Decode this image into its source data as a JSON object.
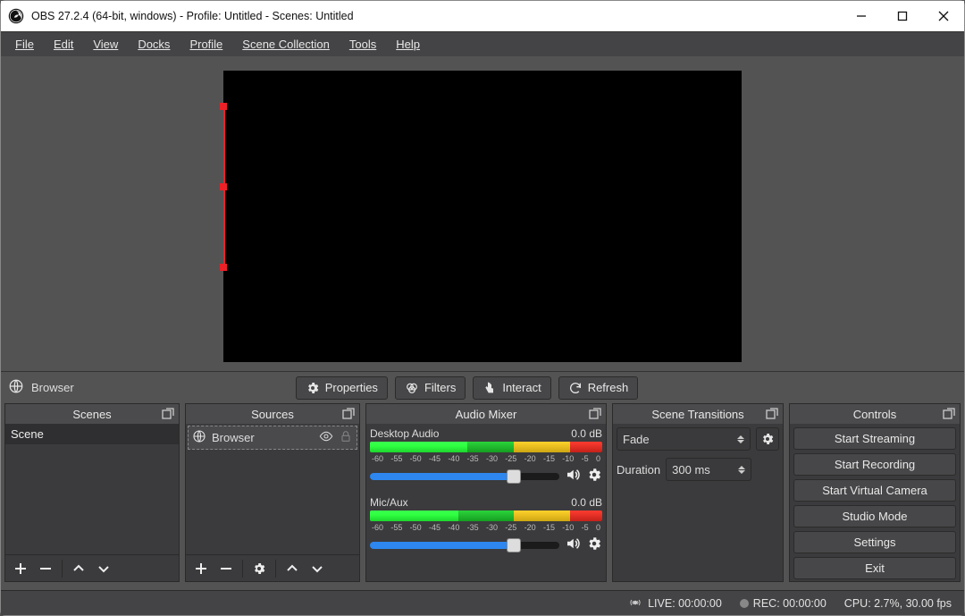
{
  "window": {
    "title": "OBS 27.2.4 (64-bit, windows) - Profile: Untitled - Scenes: Untitled"
  },
  "menu": {
    "file": "File",
    "edit": "Edit",
    "view": "View",
    "docks": "Docks",
    "profile": "Profile",
    "scenecol": "Scene Collection",
    "tools": "Tools",
    "help": "Help"
  },
  "context": {
    "source_name": "Browser",
    "properties": "Properties",
    "filters": "Filters",
    "interact": "Interact",
    "refresh": "Refresh"
  },
  "docks": {
    "scenes": {
      "title": "Scenes",
      "items": [
        "Scene"
      ]
    },
    "sources": {
      "title": "Sources",
      "items": [
        {
          "name": "Browser"
        }
      ]
    },
    "mixer": {
      "title": "Audio Mixer",
      "channels": [
        {
          "name": "Desktop Audio",
          "db": "0.0 dB",
          "ticks": [
            "-60",
            "-55",
            "-50",
            "-45",
            "-40",
            "-35",
            "-30",
            "-25",
            "-20",
            "-15",
            "-10",
            "-5",
            "0"
          ]
        },
        {
          "name": "Mic/Aux",
          "db": "0.0 dB",
          "ticks": [
            "-60",
            "-55",
            "-50",
            "-45",
            "-40",
            "-35",
            "-30",
            "-25",
            "-20",
            "-15",
            "-10",
            "-5",
            "0"
          ]
        }
      ]
    },
    "transitions": {
      "title": "Scene Transitions",
      "selected": "Fade",
      "duration_label": "Duration",
      "duration_value": "300 ms"
    },
    "controls": {
      "title": "Controls",
      "buttons": {
        "stream": "Start Streaming",
        "record": "Start Recording",
        "vcam": "Start Virtual Camera",
        "studio": "Studio Mode",
        "settings": "Settings",
        "exit": "Exit"
      }
    }
  },
  "status": {
    "live": "LIVE: 00:00:00",
    "rec": "REC: 00:00:00",
    "cpu": "CPU: 2.7%, 30.00 fps"
  }
}
